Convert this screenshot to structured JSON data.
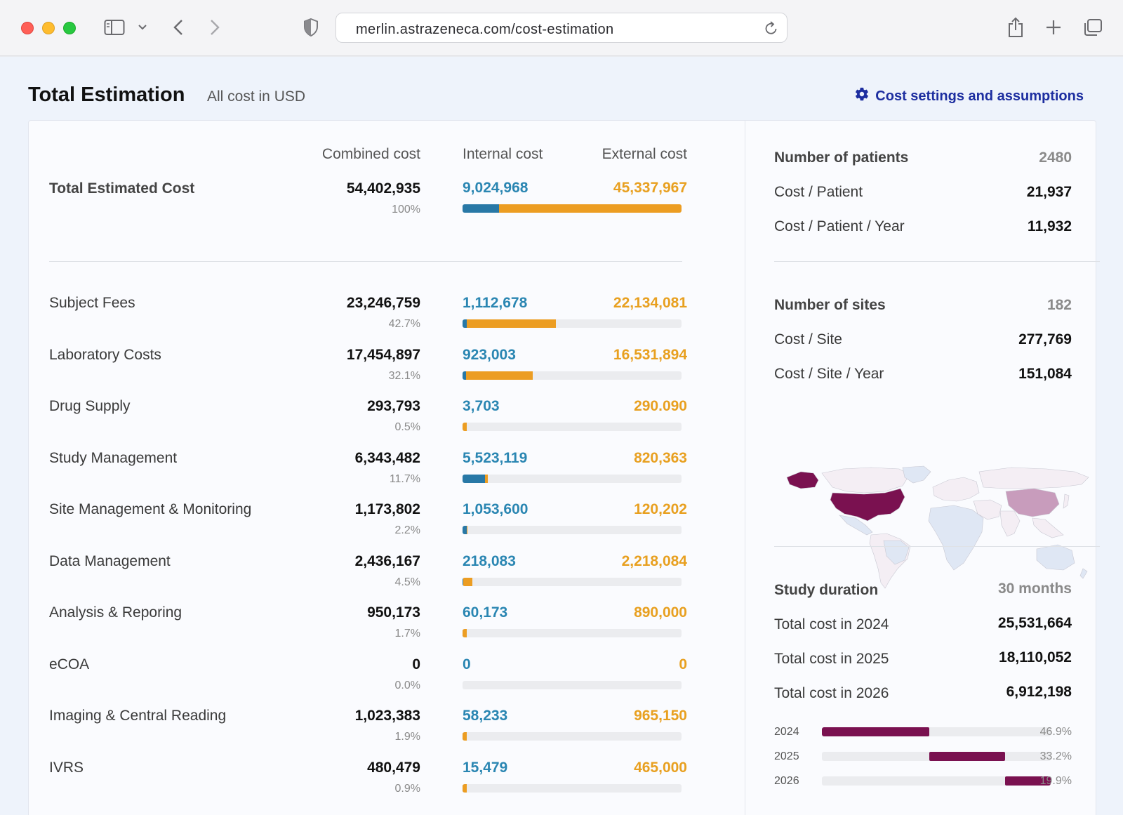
{
  "browser": {
    "url": "merlin.astrazeneca.com/cost-estimation"
  },
  "page": {
    "title": "Total Estimation",
    "subtitle": "All cost in USD",
    "settings_link": "Cost settings and assumptions"
  },
  "columns": {
    "combined": "Combined cost",
    "internal": "Internal cost",
    "external": "External cost"
  },
  "total": {
    "label": "Total Estimated Cost",
    "combined": "54,402,935",
    "pct": "100%",
    "internal": "9,024,968",
    "external": "45,337,967",
    "share_of_total": 1.0,
    "internal_fraction": 0.166
  },
  "rows": [
    {
      "label": "Subject Fees",
      "combined": "23,246,759",
      "pct": "42.7%",
      "internal": "1,112,678",
      "external": "22,134,081",
      "share_of_total": 0.427,
      "internal_fraction": 0.048
    },
    {
      "label": "Laboratory Costs",
      "combined": "17,454,897",
      "pct": "32.1%",
      "internal": "923,003",
      "external": "16,531,894",
      "share_of_total": 0.321,
      "internal_fraction": 0.053
    },
    {
      "label": "Drug Supply",
      "combined": "293,793",
      "pct": "0.5%",
      "internal": "3,703",
      "external": "290.090",
      "share_of_total": 0.005,
      "internal_fraction": 0.013
    },
    {
      "label": "Study Management",
      "combined": "6,343,482",
      "pct": "11.7%",
      "internal": "5,523,119",
      "external": "820,363",
      "share_of_total": 0.117,
      "internal_fraction": 0.871
    },
    {
      "label": "Site Management & Monitoring",
      "combined": "1,173,802",
      "pct": "2.2%",
      "internal": "1,053,600",
      "external": "120,202",
      "share_of_total": 0.022,
      "internal_fraction": 0.898
    },
    {
      "label": "Data Management",
      "combined": "2,436,167",
      "pct": "4.5%",
      "internal": "218,083",
      "external": "2,218,084",
      "share_of_total": 0.045,
      "internal_fraction": 0.09
    },
    {
      "label": "Analysis & Reporing",
      "combined": "950,173",
      "pct": "1.7%",
      "internal": "60,173",
      "external": "890,000",
      "share_of_total": 0.017,
      "internal_fraction": 0.063
    },
    {
      "label": "eCOA",
      "combined": "0",
      "pct": "0.0%",
      "internal": "0",
      "external": "0",
      "share_of_total": 0.0,
      "internal_fraction": 0.0
    },
    {
      "label": "Imaging & Central Reading",
      "combined": "1,023,383",
      "pct": "1.9%",
      "internal": "58,233",
      "external": "965,150",
      "share_of_total": 0.019,
      "internal_fraction": 0.057
    },
    {
      "label": "IVRS",
      "combined": "480,479",
      "pct": "0.9%",
      "internal": "15,479",
      "external": "465,000",
      "share_of_total": 0.009,
      "internal_fraction": 0.032
    }
  ],
  "patients": {
    "label": "Number of patients",
    "value": "2480",
    "per_patient_label": "Cost / Patient",
    "per_patient": "21,937",
    "per_patient_year_label": "Cost / Patient / Year",
    "per_patient_year": "11,932"
  },
  "sites": {
    "label": "Number of sites",
    "value": "182",
    "per_site_label": "Cost / Site",
    "per_site": "277,769",
    "per_site_year_label": "Cost / Site / Year",
    "per_site_year": "151,084"
  },
  "duration": {
    "label": "Study duration",
    "value": "30 months",
    "years": [
      {
        "label": "Total cost in 2024",
        "year": "2024",
        "value": "25,531,664",
        "pct": "46.9%",
        "start_fraction": 0.0,
        "share": 0.469
      },
      {
        "label": "Total cost in 2025",
        "year": "2025",
        "value": "18,110,052",
        "pct": "33.2%",
        "start_fraction": 0.469,
        "share": 0.332
      },
      {
        "label": "Total cost in 2026",
        "year": "2026",
        "value": "6,912,198",
        "pct": "19.9%",
        "start_fraction": 0.801,
        "share": 0.199
      }
    ]
  },
  "colors": {
    "internal": "#2878a6",
    "external": "#ec9d22",
    "duration_bar": "#7a1150",
    "link": "#1d2ea0"
  },
  "icons": [
    "sidebar-icon",
    "chevron-down-icon",
    "back-icon",
    "forward-icon",
    "shield-icon",
    "reload-icon",
    "share-icon",
    "plus-icon",
    "tabs-icon",
    "gear-icon",
    "world-map"
  ]
}
